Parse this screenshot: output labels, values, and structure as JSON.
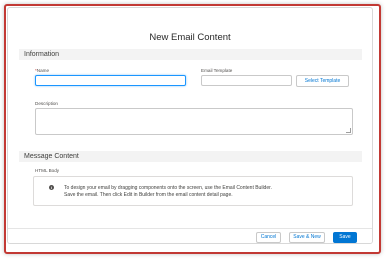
{
  "modal": {
    "title": "New Email Content"
  },
  "sections": {
    "information": "Information",
    "message_content": "Message Content"
  },
  "fields": {
    "name_label": "Name",
    "name_required": "*",
    "name_value": "",
    "email_template_label": "Email Template",
    "email_template_value": "",
    "select_template_label": "Select Template",
    "description_label": "Description",
    "description_value": "",
    "html_body_label": "HTML Body"
  },
  "info": {
    "icon": "info-icon",
    "line1": "To design your email by dragging components onto the screen, use the Email Content Builder.",
    "line2": "Save the email. Then click Edit in Builder from the email content detail page."
  },
  "footer": {
    "cancel_label": "Cancel",
    "save_new_label": "Save & New",
    "save_label": "Save"
  },
  "colors": {
    "brand": "#0176d3",
    "frame_border": "#c23934",
    "focus": "#1b96ff"
  }
}
